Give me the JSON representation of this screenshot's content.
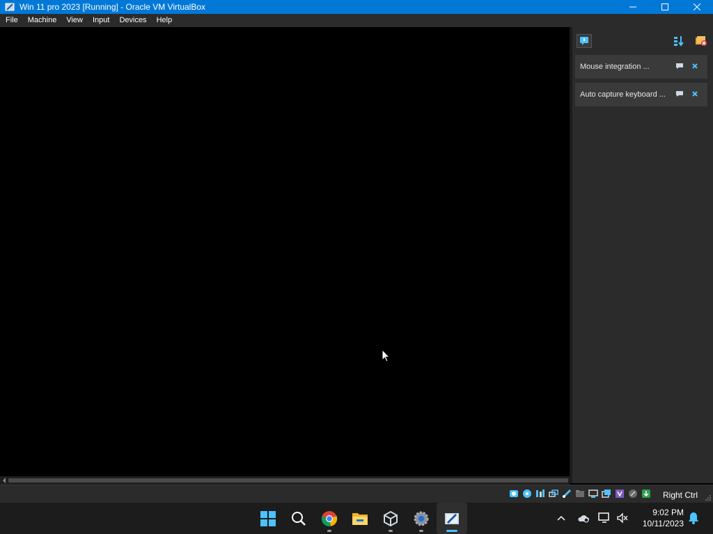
{
  "window": {
    "title": "Win 11 pro 2023 [Running] - Oracle VM VirtualBox",
    "icon": "virtualbox-icon"
  },
  "menu": {
    "items": [
      "File",
      "Machine",
      "View",
      "Input",
      "Devices",
      "Help"
    ]
  },
  "notifications": {
    "items": [
      {
        "label": "Mouse integration ..."
      },
      {
        "label": "Auto capture keyboard ..."
      }
    ]
  },
  "statusbar": {
    "host_key": "Right Ctrl",
    "icons": [
      "hard-disk-icon",
      "optical-drive-icon",
      "audio-icon",
      "network-icon",
      "usb-icon",
      "shared-folders-icon",
      "display-icon",
      "recording-icon",
      "vt-x-icon",
      "mouse-integration-icon",
      "keyboard-capture-icon"
    ]
  },
  "taskbar": {
    "apps": [
      "start-icon",
      "search-icon",
      "chrome-icon",
      "file-explorer-icon",
      "virtualbox-manager-icon",
      "settings-icon",
      "virtualbox-vm-icon"
    ],
    "time": "9:02 PM",
    "date": "10/11/2023"
  },
  "colors": {
    "titlebar": "#0078d7",
    "menubar": "#2b2b2b",
    "taskbar": "#1c1c1c",
    "accent": "#4cc2ff"
  }
}
